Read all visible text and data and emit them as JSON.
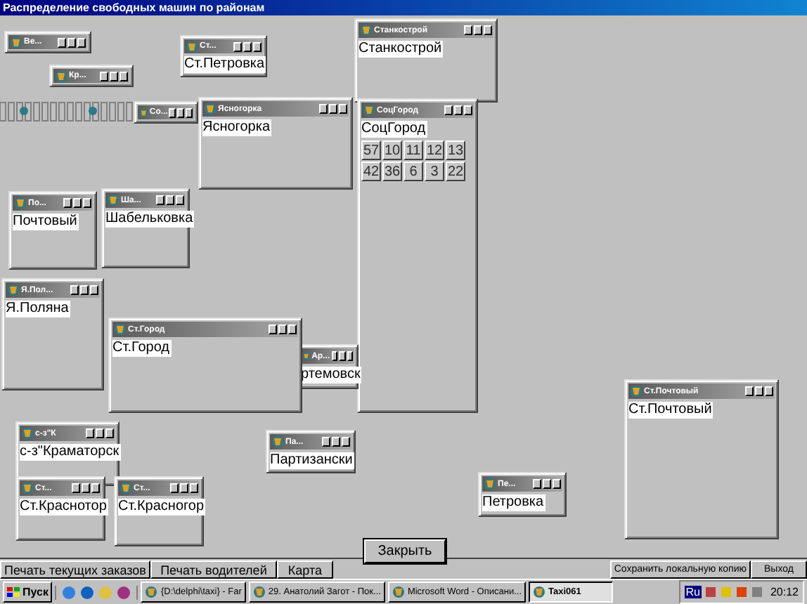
{
  "window": {
    "title": "Распределение свободных машин по районам"
  },
  "child_windows": [
    {
      "title": "Ве..."
    },
    {
      "title": "Кр..."
    },
    {
      "title": "Ст...",
      "label": "Ст.Петровка"
    },
    {
      "title": "Со..."
    },
    {
      "title": "Станкострой",
      "label": "Станкострой"
    },
    {
      "title": "Ясногорка",
      "label": "Ясногорка"
    },
    {
      "title": "СоцГород",
      "label": "СоцГород",
      "counts": [
        [
          "57",
          "10",
          "11",
          "12",
          "13"
        ],
        [
          "42",
          "36",
          "6",
          "3",
          "22"
        ]
      ]
    },
    {
      "title": "По...",
      "label": "Почтовый"
    },
    {
      "title": "Ша...",
      "label": "Шабельковка"
    },
    {
      "title": "Я.Пол...",
      "label": "Я.Поляна"
    },
    {
      "title": "Ар...",
      "label": "ртемовск"
    },
    {
      "title": "Ст.Город",
      "label": "Ст.Город"
    },
    {
      "title": "с-з\"К",
      "label": "с-з\"Краматорск"
    },
    {
      "title": "Ст...",
      "label": "Ст.Краснотор"
    },
    {
      "title": "Ст...",
      "label": "Ст.Красногор"
    },
    {
      "title": "Па...",
      "label": "Партизански"
    },
    {
      "title": "Пе...",
      "label": "Петровка"
    },
    {
      "title": "Ст.Почтовый",
      "label": "Ст.Почтовый"
    }
  ],
  "close_button": "Закрыть",
  "left_buttons": [
    "Печать текущих заказов",
    "Печать водителей",
    "Карта"
  ],
  "right_buttons": [
    "Сохранить локальную копию",
    "Выход"
  ],
  "taskbar": {
    "start": "Пуск",
    "tasks": [
      {
        "label": "{D:\\delphi\\taxi} - Far",
        "selected": false
      },
      {
        "label": "29. Анатолий Загот - Пок...",
        "selected": false
      },
      {
        "label": "Microsoft Word - Описани...",
        "selected": false
      },
      {
        "label": "Taxi061",
        "selected": true
      }
    ],
    "language": "Ru",
    "clock": "20:12"
  }
}
